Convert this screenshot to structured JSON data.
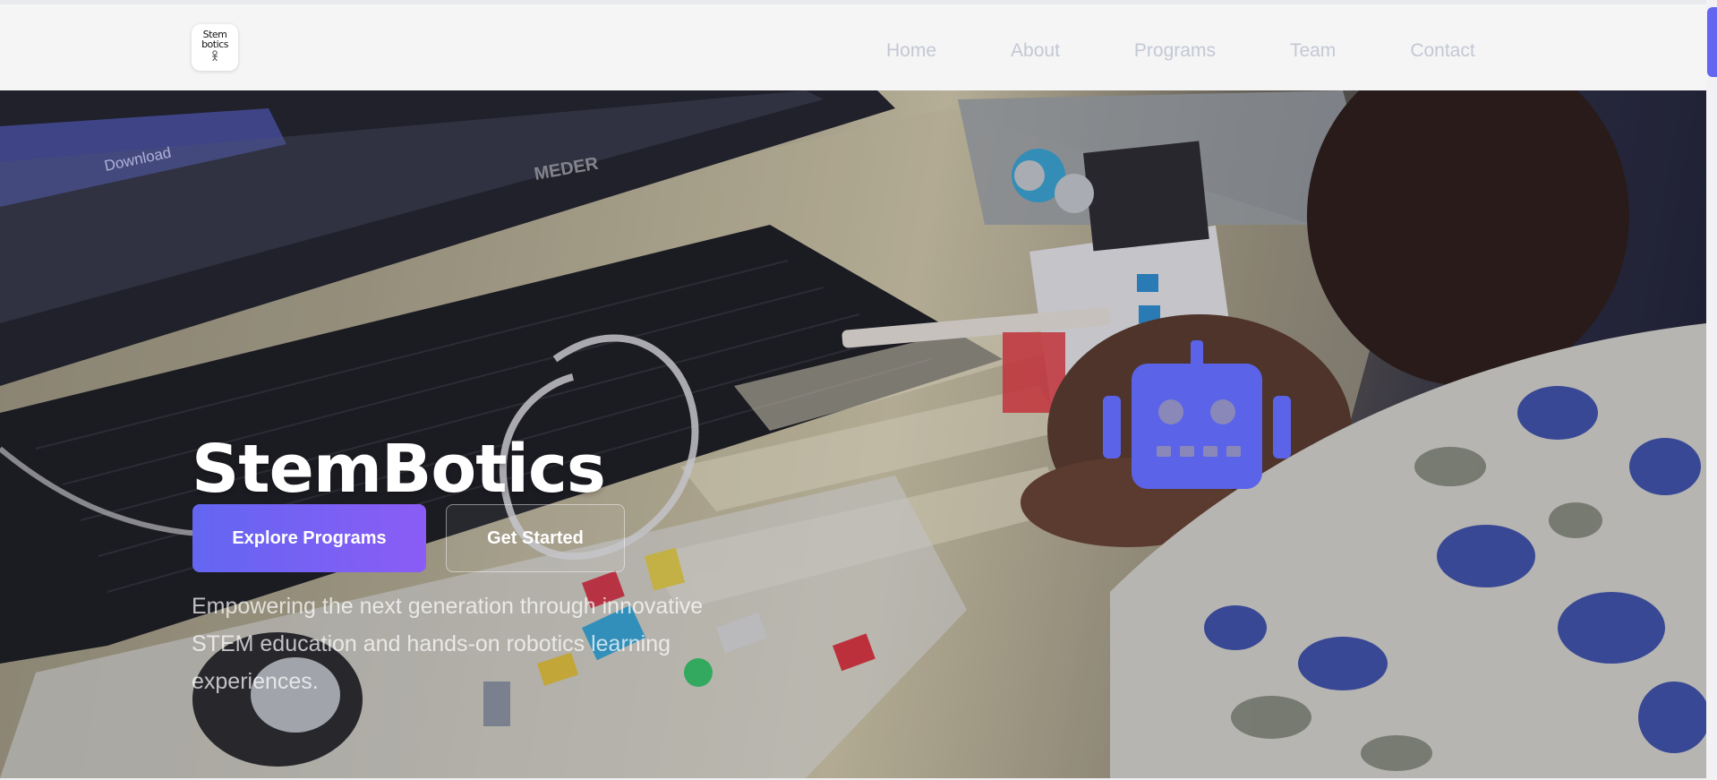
{
  "header": {
    "logo_text_line1": "Stem",
    "logo_text_line2": "botics",
    "nav": [
      "Home",
      "About",
      "Programs",
      "Team",
      "Contact"
    ]
  },
  "hero": {
    "title": "StemBotics",
    "primary_button": "Explore Programs",
    "secondary_button": "Get Started",
    "subtitle": "Empowering the next generation through innovative STEM education and hands-on robotics learning experiences.",
    "monitor_button_text": "Download",
    "monitor_brand": "MEDER"
  },
  "colors": {
    "accent": "#6366f1",
    "accent_gradient_end": "#8b5cf6",
    "nav_text": "#c3c8d3"
  },
  "icons": [
    "robot-icon",
    "logo-robot-icon"
  ]
}
